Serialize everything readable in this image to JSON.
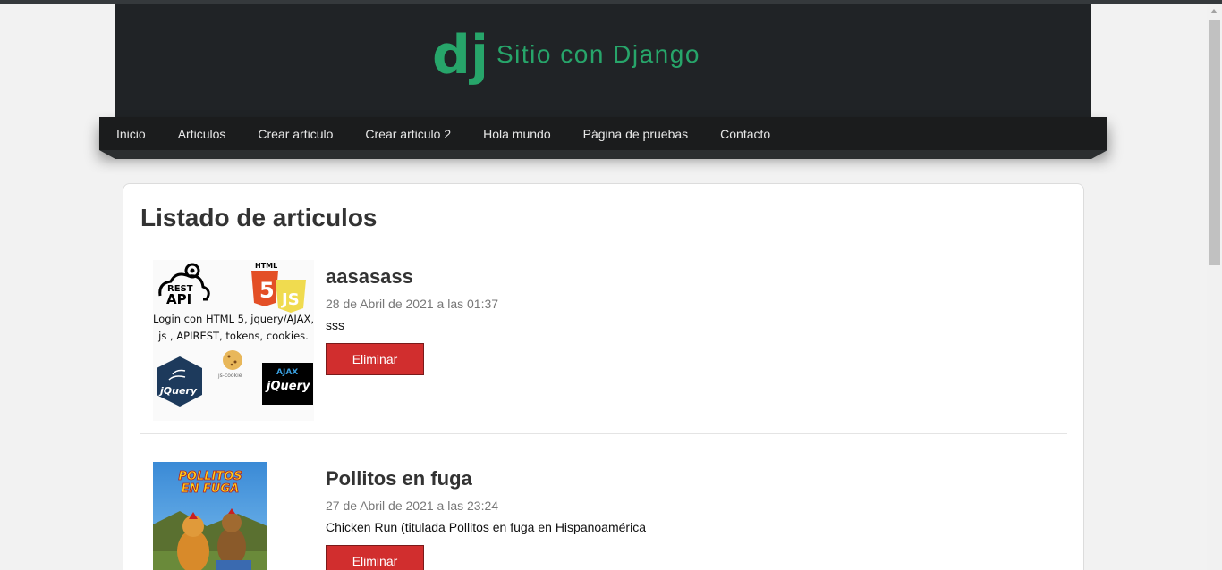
{
  "header": {
    "logo_text": "dj",
    "site_title": "Sitio con Django",
    "brand_color": "#27a56a"
  },
  "nav": {
    "items": [
      {
        "label": "Inicio"
      },
      {
        "label": "Articulos"
      },
      {
        "label": "Crear articulo"
      },
      {
        "label": "Crear articulo 2"
      },
      {
        "label": "Hola mundo"
      },
      {
        "label": "Página de pruebas"
      },
      {
        "label": "Contacto"
      }
    ]
  },
  "main": {
    "page_title": "Listado de articulos",
    "articles": [
      {
        "title": "aasasass",
        "date": "28 de Abril de 2021 a las 01:37",
        "body": "sss",
        "delete_label": "Eliminar",
        "image": {
          "badge_rest_line1": "REST",
          "badge_rest_line2": "API",
          "badge_html": "HTML",
          "badge_html_num": "5",
          "badge_js": "JS",
          "caption_line1": "Login con HTML 5, jquery/AJAX,",
          "caption_line2": "js , APIREST, tokens, cookies.",
          "badge_jquery": "jQuery",
          "badge_cookie": "js-cookie",
          "badge_ajax": "AJAX",
          "badge_jquery2": "jQuery"
        }
      },
      {
        "title": "Pollitos en fuga",
        "date": "27 de Abril de 2021 a las 23:24",
        "body": "Chicken Run (titulada Pollitos en fuga en Hispanoamérica",
        "delete_label": "Eliminar",
        "image": {
          "poster_line1": "POLLITOS",
          "poster_line2": "EN FUGA"
        }
      }
    ]
  },
  "colors": {
    "header_bg": "#202326",
    "nav_bg": "#1b1c1d",
    "danger": "#d12e2e"
  }
}
